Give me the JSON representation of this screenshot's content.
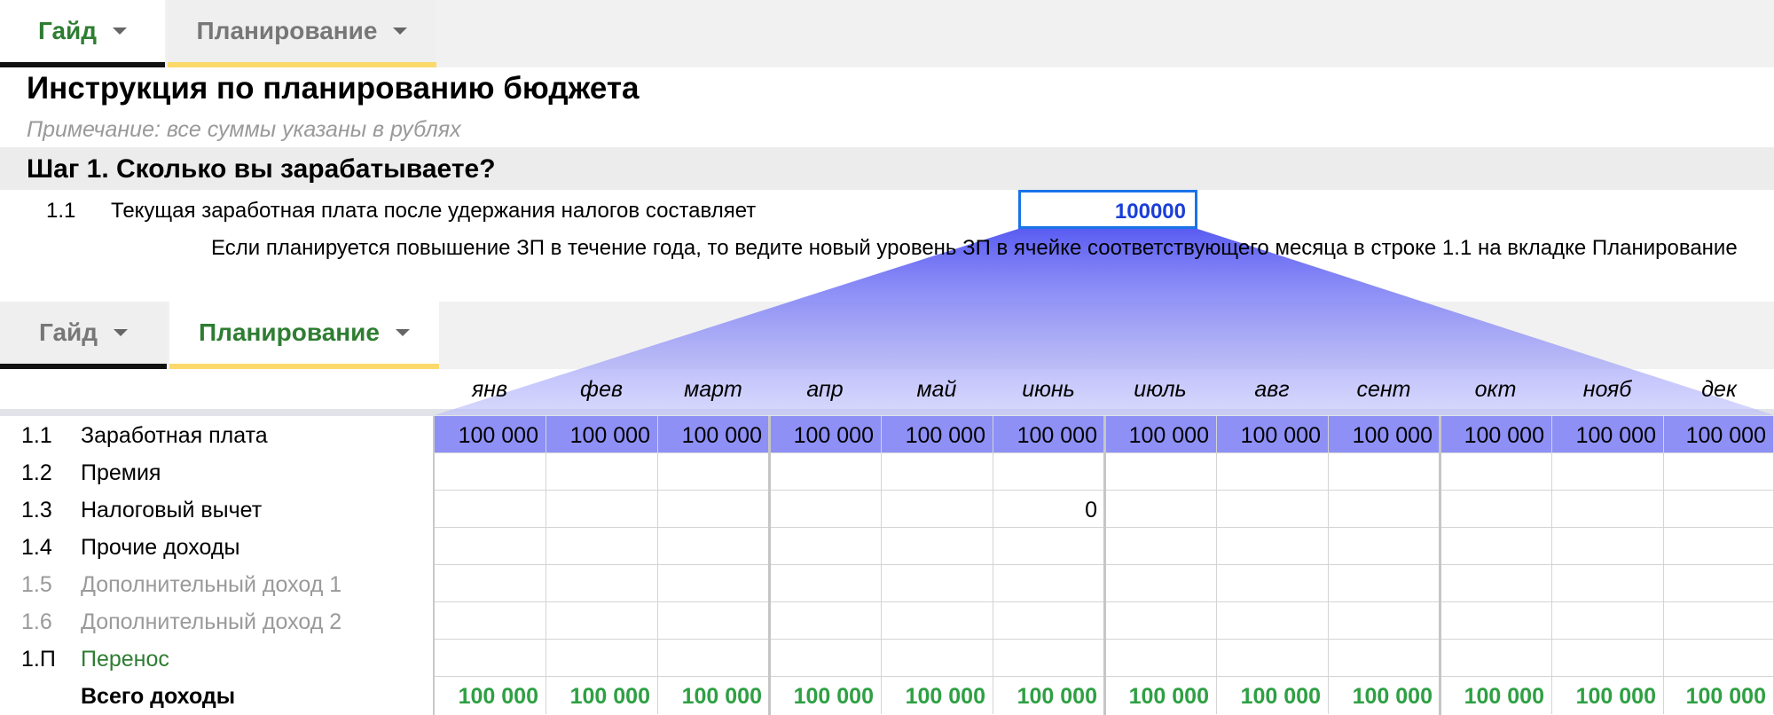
{
  "top_tabs": [
    {
      "label": "Гайд",
      "active": true
    },
    {
      "label": "Планирование",
      "active": false
    }
  ],
  "guide": {
    "title": "Инструкция по планированию бюджета",
    "note": "Примечание: все суммы указаны в рублях",
    "step1_title": "Шаг 1. Сколько вы зарабатываете?",
    "row11_num": "1.1",
    "row11_text": "Текущая заработная плата после удержания налогов составляет",
    "salary_value": "100000",
    "hint": "Если планируется повышение ЗП в течение года, то ведите новый уровень ЗП в ячейке соответствующего месяца в строке 1.1 на вкладке Планирование"
  },
  "lower_tabs": [
    {
      "label": "Гайд",
      "active": false
    },
    {
      "label": "Планирование",
      "active": true
    }
  ],
  "months": [
    "янв",
    "фев",
    "март",
    "апр",
    "май",
    "июнь",
    "июль",
    "авг",
    "сент",
    "окт",
    "нояб",
    "дек"
  ],
  "rows": [
    {
      "num": "1.1",
      "label": "Заработная плата",
      "values": [
        "100 000",
        "100 000",
        "100 000",
        "100 000",
        "100 000",
        "100 000",
        "100 000",
        "100 000",
        "100 000",
        "100 000",
        "100 000",
        "100 000"
      ]
    },
    {
      "num": "1.2",
      "label": "Премия",
      "values": [
        "",
        "",
        "",
        "",
        "",
        "",
        "",
        "",
        "",
        "",
        "",
        ""
      ]
    },
    {
      "num": "1.3",
      "label": "Налоговый вычет",
      "values": [
        "",
        "",
        "",
        "",
        "",
        "0",
        "",
        "",
        "",
        "",
        "",
        ""
      ]
    },
    {
      "num": "1.4",
      "label": "Прочие доходы",
      "values": [
        "",
        "",
        "",
        "",
        "",
        "",
        "",
        "",
        "",
        "",
        "",
        ""
      ]
    },
    {
      "num": "1.5",
      "label": "Дополнительный доход 1",
      "values": [
        "",
        "",
        "",
        "",
        "",
        "",
        "",
        "",
        "",
        "",
        "",
        ""
      ]
    },
    {
      "num": "1.6",
      "label": "Дополнительный доход 2",
      "values": [
        "",
        "",
        "",
        "",
        "",
        "",
        "",
        "",
        "",
        "",
        "",
        ""
      ]
    },
    {
      "num": "1.П",
      "label": "Перенос",
      "values": [
        "",
        "",
        "",
        "",
        "",
        "",
        "",
        "",
        "",
        "",
        "",
        ""
      ]
    },
    {
      "num": "",
      "label": "Всего доходы",
      "values": [
        "100 000",
        "100 000",
        "100 000",
        "100 000",
        "100 000",
        "100 000",
        "100 000",
        "100 000",
        "100 000",
        "100 000",
        "100 000",
        "100 000"
      ]
    }
  ],
  "colors": {
    "accent_green": "#2e7d32",
    "salary_row": "#8e90f6",
    "input_border": "#1a73e8",
    "tab_yellow": "#fbd96b"
  }
}
